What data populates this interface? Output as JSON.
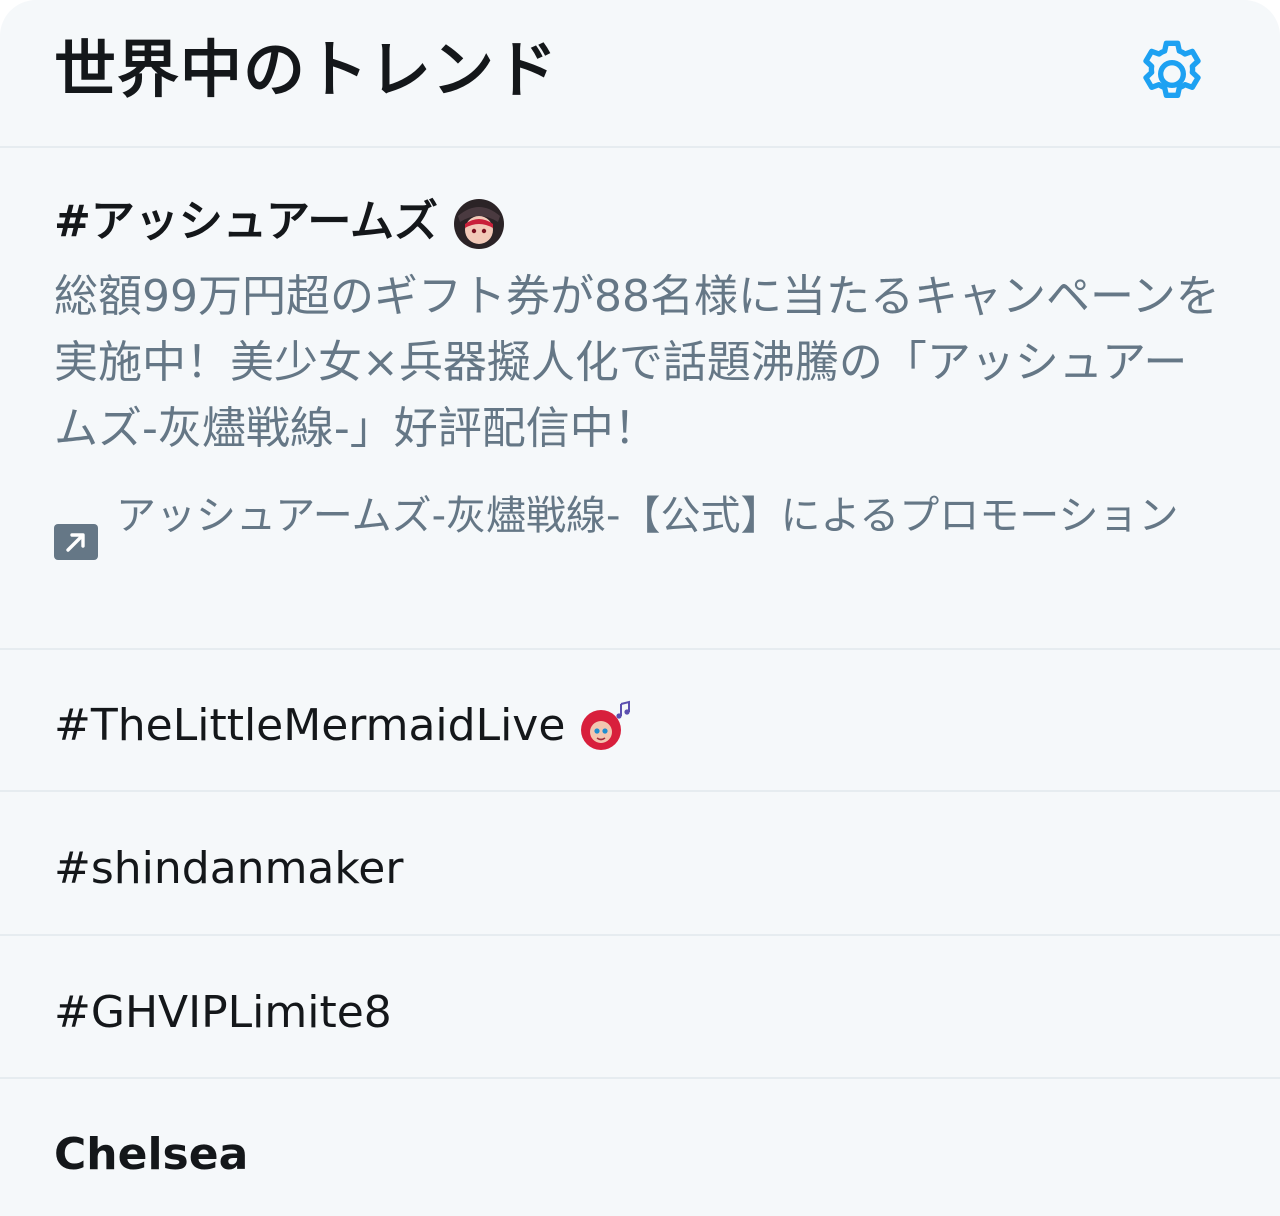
{
  "header": {
    "title": "世界中のトレンド",
    "settings_icon": "gear-icon",
    "accent_color": "#1da1f2"
  },
  "trends": [
    {
      "name": "#アッシュアームズ",
      "emoji": "character-emoji",
      "description": "総額99万円超のギフト券が88名様に当たるキャンペーンを実施中！美少女×兵器擬人化で話題沸騰の「アッシュアームズ-灰燼戦線-」好評配信中！",
      "promoted_by": "アッシュアームズ-灰燼戦線-【公式】によるプロモーション",
      "promoted_icon": "promoted-arrow-icon"
    },
    {
      "name": "#TheLittleMermaidLive",
      "emoji": "mermaid-emoji"
    },
    {
      "name": "#shindanmaker"
    },
    {
      "name": "#GHVIPLimite8"
    },
    {
      "name": "Chelsea"
    }
  ]
}
